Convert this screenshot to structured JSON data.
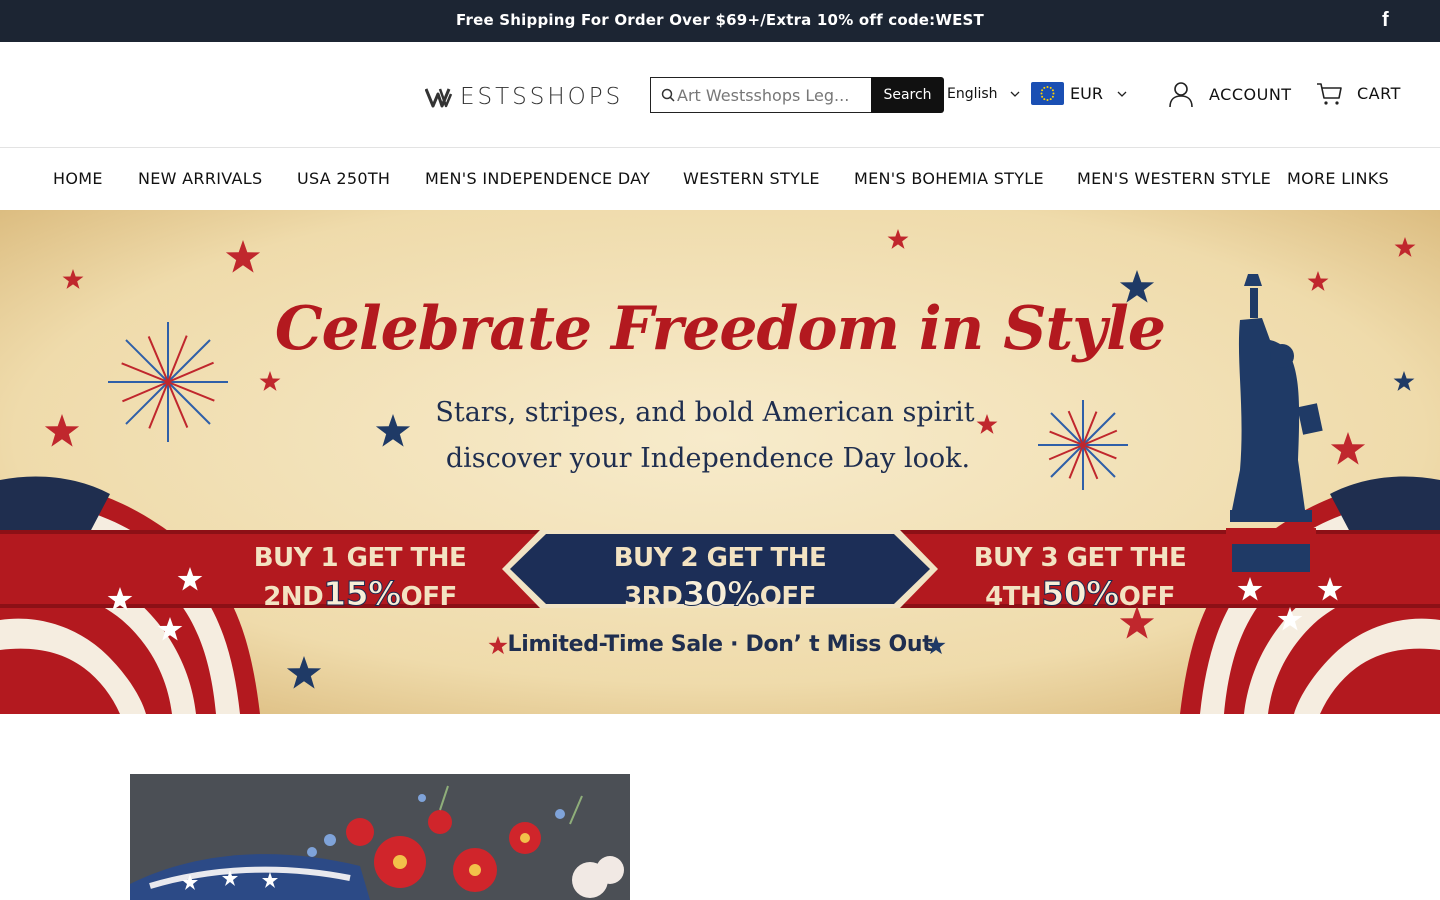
{
  "announcement": {
    "text": "Free Shipping For Order Over $69+/Extra 10% off code:WEST",
    "social": "f"
  },
  "header": {
    "logo": "ESTSSHOPS",
    "search": {
      "placeholder": "Art Westsshops Leg...",
      "button": "Search"
    },
    "language": "English",
    "currency": "EUR",
    "account": "ACCOUNT",
    "cart": "CART"
  },
  "nav": {
    "items": [
      {
        "label": "HOME"
      },
      {
        "label": "NEW ARRIVALS"
      },
      {
        "label": "USA 250TH"
      },
      {
        "label": "MEN'S INDEPENDENCE DAY"
      },
      {
        "label": "WESTERN STYLE"
      },
      {
        "label": "MEN'S BOHEMIA STYLE"
      },
      {
        "label": "MEN'S WESTERN STYLE"
      },
      {
        "label": "MORE LINKS"
      }
    ]
  },
  "hero": {
    "title": "Celebrate Freedom in Style",
    "subtitle1": "Stars, stripes, and bold American spirit",
    "subtitle2": "discover your Independence Day look.",
    "offers": [
      {
        "line1": "BUY 1 GET THE",
        "prefix": "2ND",
        "pct": "15%",
        "suffix": "OFF"
      },
      {
        "line1": "BUY 2 GET THE",
        "prefix": "3RD",
        "pct": "30%",
        "suffix": "OFF"
      },
      {
        "line1": "BUY 3 GET THE",
        "prefix": "4TH",
        "pct": "50%",
        "suffix": "OFF"
      }
    ],
    "limited": "Limited-Time Sale · Don’ t Miss Out"
  },
  "colors": {
    "topbar": "#1c2533",
    "accent_red": "#b3191f",
    "navy": "#1f2e4f",
    "parchment": "#efdcb0"
  }
}
